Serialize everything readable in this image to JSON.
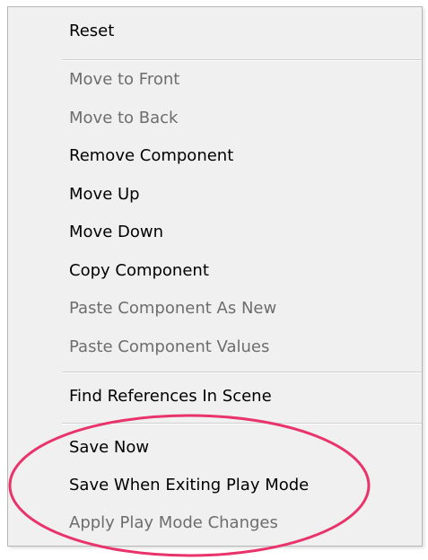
{
  "menu": {
    "items": [
      {
        "label": "Reset",
        "enabled": true
      },
      {
        "label": "Move to Front",
        "enabled": false
      },
      {
        "label": "Move to Back",
        "enabled": false
      },
      {
        "label": "Remove Component",
        "enabled": true
      },
      {
        "label": "Move Up",
        "enabled": true
      },
      {
        "label": "Move Down",
        "enabled": true
      },
      {
        "label": "Copy Component",
        "enabled": true
      },
      {
        "label": "Paste Component As New",
        "enabled": false
      },
      {
        "label": "Paste Component Values",
        "enabled": false
      },
      {
        "label": "Find References In Scene",
        "enabled": true
      },
      {
        "label": "Save Now",
        "enabled": true
      },
      {
        "label": "Save When Exiting Play Mode",
        "enabled": true
      },
      {
        "label": "Apply Play Mode Changes",
        "enabled": false
      }
    ]
  },
  "colors": {
    "menu_background": "#f0f0f0",
    "enabled_text": "#000000",
    "disabled_text": "#6d6d6d",
    "highlight_ellipse": "#e8336b"
  }
}
